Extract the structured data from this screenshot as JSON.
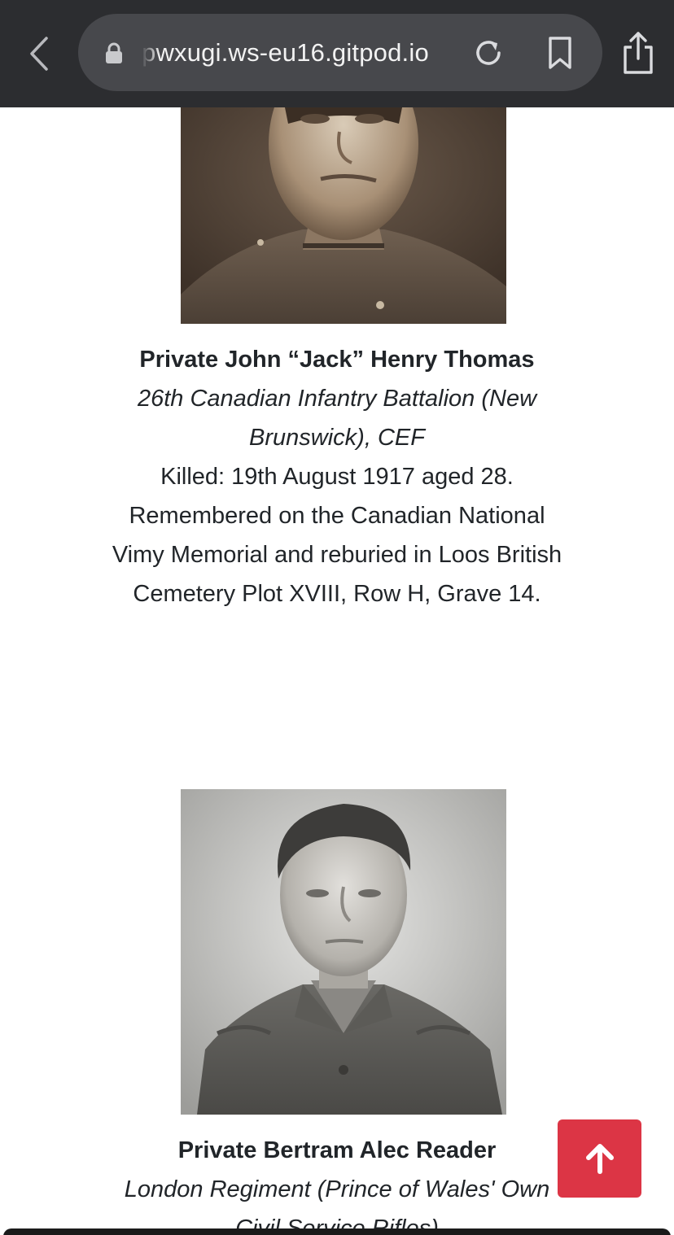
{
  "browser": {
    "url": "pwxugi.ws-eu16.gitpod.io",
    "icons": [
      "back-icon",
      "lock-icon",
      "reload-icon",
      "bookmark-icon",
      "share-icon"
    ]
  },
  "entries": [
    {
      "name": "Private John “Jack” Henry Thomas",
      "unit": "26th Canadian Infantry Battalion (New Brunswick), CEF",
      "detail": "Killed: 19th August 1917 aged 28. Remembered on the Canadian National Vimy Memorial and reburied in Loos British Cemetery Plot XVIII, Row H, Grave 14."
    },
    {
      "name": "Private Bertram Alec Reader",
      "unit": "London Regiment (Prince of Wales' Own Civil Service Rifles)"
    }
  ],
  "scroll_top": {
    "icon": "arrow-up-icon",
    "color": "#dc3545"
  },
  "colors": {
    "toolbar": "#2c2d30",
    "urlbar": "#47484c",
    "text": "#212529"
  }
}
